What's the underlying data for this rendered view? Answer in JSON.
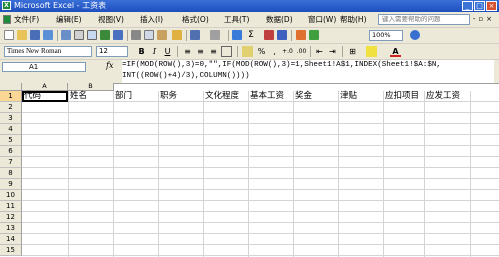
{
  "window": {
    "title": "Microsoft Excel - 工资表"
  },
  "menu": {
    "items": [
      "文件(F)",
      "编辑(E)",
      "视图(V)",
      "插入(I)",
      "格式(O)",
      "工具(T)",
      "数据(D)",
      "窗口(W)",
      "帮助(H)"
    ],
    "help_placeholder": "键入需要帮助的问题"
  },
  "toolbar": {
    "zoom": "100%"
  },
  "format_toolbar": {
    "font": "Times New Roman",
    "size": "12"
  },
  "formula_bar": {
    "name_box": "A1",
    "fx": "fx",
    "formula_line1": "=IF(MOD(ROW(),3)=0,\"\",IF(MOD(ROW(),3)=1,Sheet1!A$1,INDEX(Sheet1!$A:$N,",
    "formula_line2": "INT((ROW()+4)/3),COLUMN())))"
  },
  "sheet": {
    "columns": [
      "A",
      "B"
    ],
    "rows": [
      "1",
      "2",
      "3",
      "4",
      "5",
      "6",
      "7",
      "8",
      "9",
      "10",
      "11",
      "12",
      "13",
      "14",
      "15"
    ],
    "header_row": [
      "代码",
      "姓名",
      "部门",
      "职务",
      "文化程度",
      "基本工资",
      "奖金",
      "津贴",
      "应扣项目",
      "应发工资"
    ]
  }
}
